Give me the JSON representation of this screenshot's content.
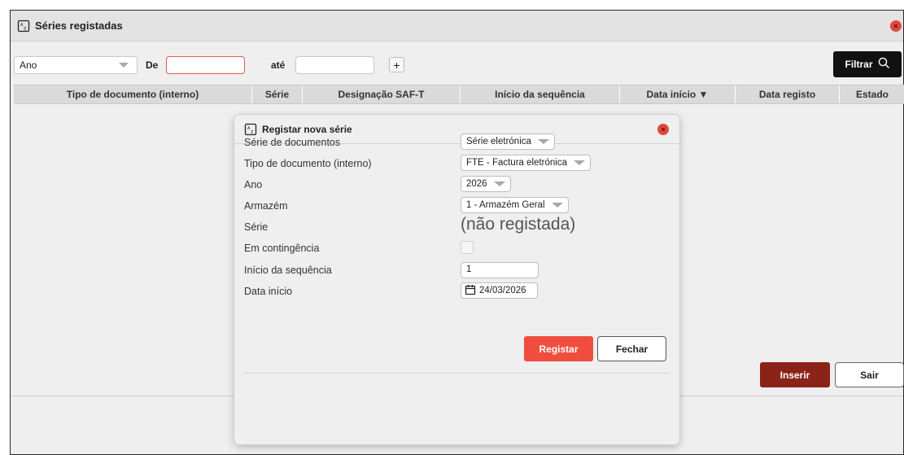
{
  "window": {
    "title": "Séries registadas",
    "title_icon": "document-icon",
    "close_icon": "close-icon"
  },
  "filter": {
    "year_select_value": "Ano",
    "from_label": "De",
    "from_value": "",
    "to_label": "até",
    "to_value": "",
    "add_label": "+",
    "filter_button_label": "Filtrar",
    "filter_icon": "search-icon"
  },
  "grid": {
    "columns": [
      "Tipo de documento (interno)",
      "Série",
      "Designação SAF-T",
      "Início da sequência",
      "Data início ▼",
      "Data registo",
      "Estado"
    ]
  },
  "actions": {
    "insert_label": "Inserir",
    "exit_label": "Sair"
  },
  "dialog": {
    "title": "Registar nova série",
    "fields": {
      "serie_documentos": {
        "label": "Série de documentos",
        "value": "Série eletrónica"
      },
      "tipo_documento": {
        "label": "Tipo de documento (interno)",
        "value": "FTE - Factura eletrónica"
      },
      "ano": {
        "label": "Ano",
        "value": "2026"
      },
      "armazem": {
        "label": "Armazém",
        "value": "1 - Armazém Geral"
      },
      "serie": {
        "label": "Série",
        "value": "(não registada)"
      },
      "contingencia": {
        "label": "Em contingência",
        "checked": false
      },
      "inicio_sequencia": {
        "label": "Início da sequência",
        "value": "1"
      },
      "data_inicio": {
        "label": "Data início",
        "value": "24/03/2026"
      }
    },
    "register_label": "Registar",
    "close_label": "Fechar"
  },
  "colors": {
    "filter_button": "#111111",
    "inserir_button": "#8b2318",
    "registar_button": "#ef4e3e",
    "close_dot": "#e04a3f",
    "date_input_border": "#e05a4f"
  }
}
